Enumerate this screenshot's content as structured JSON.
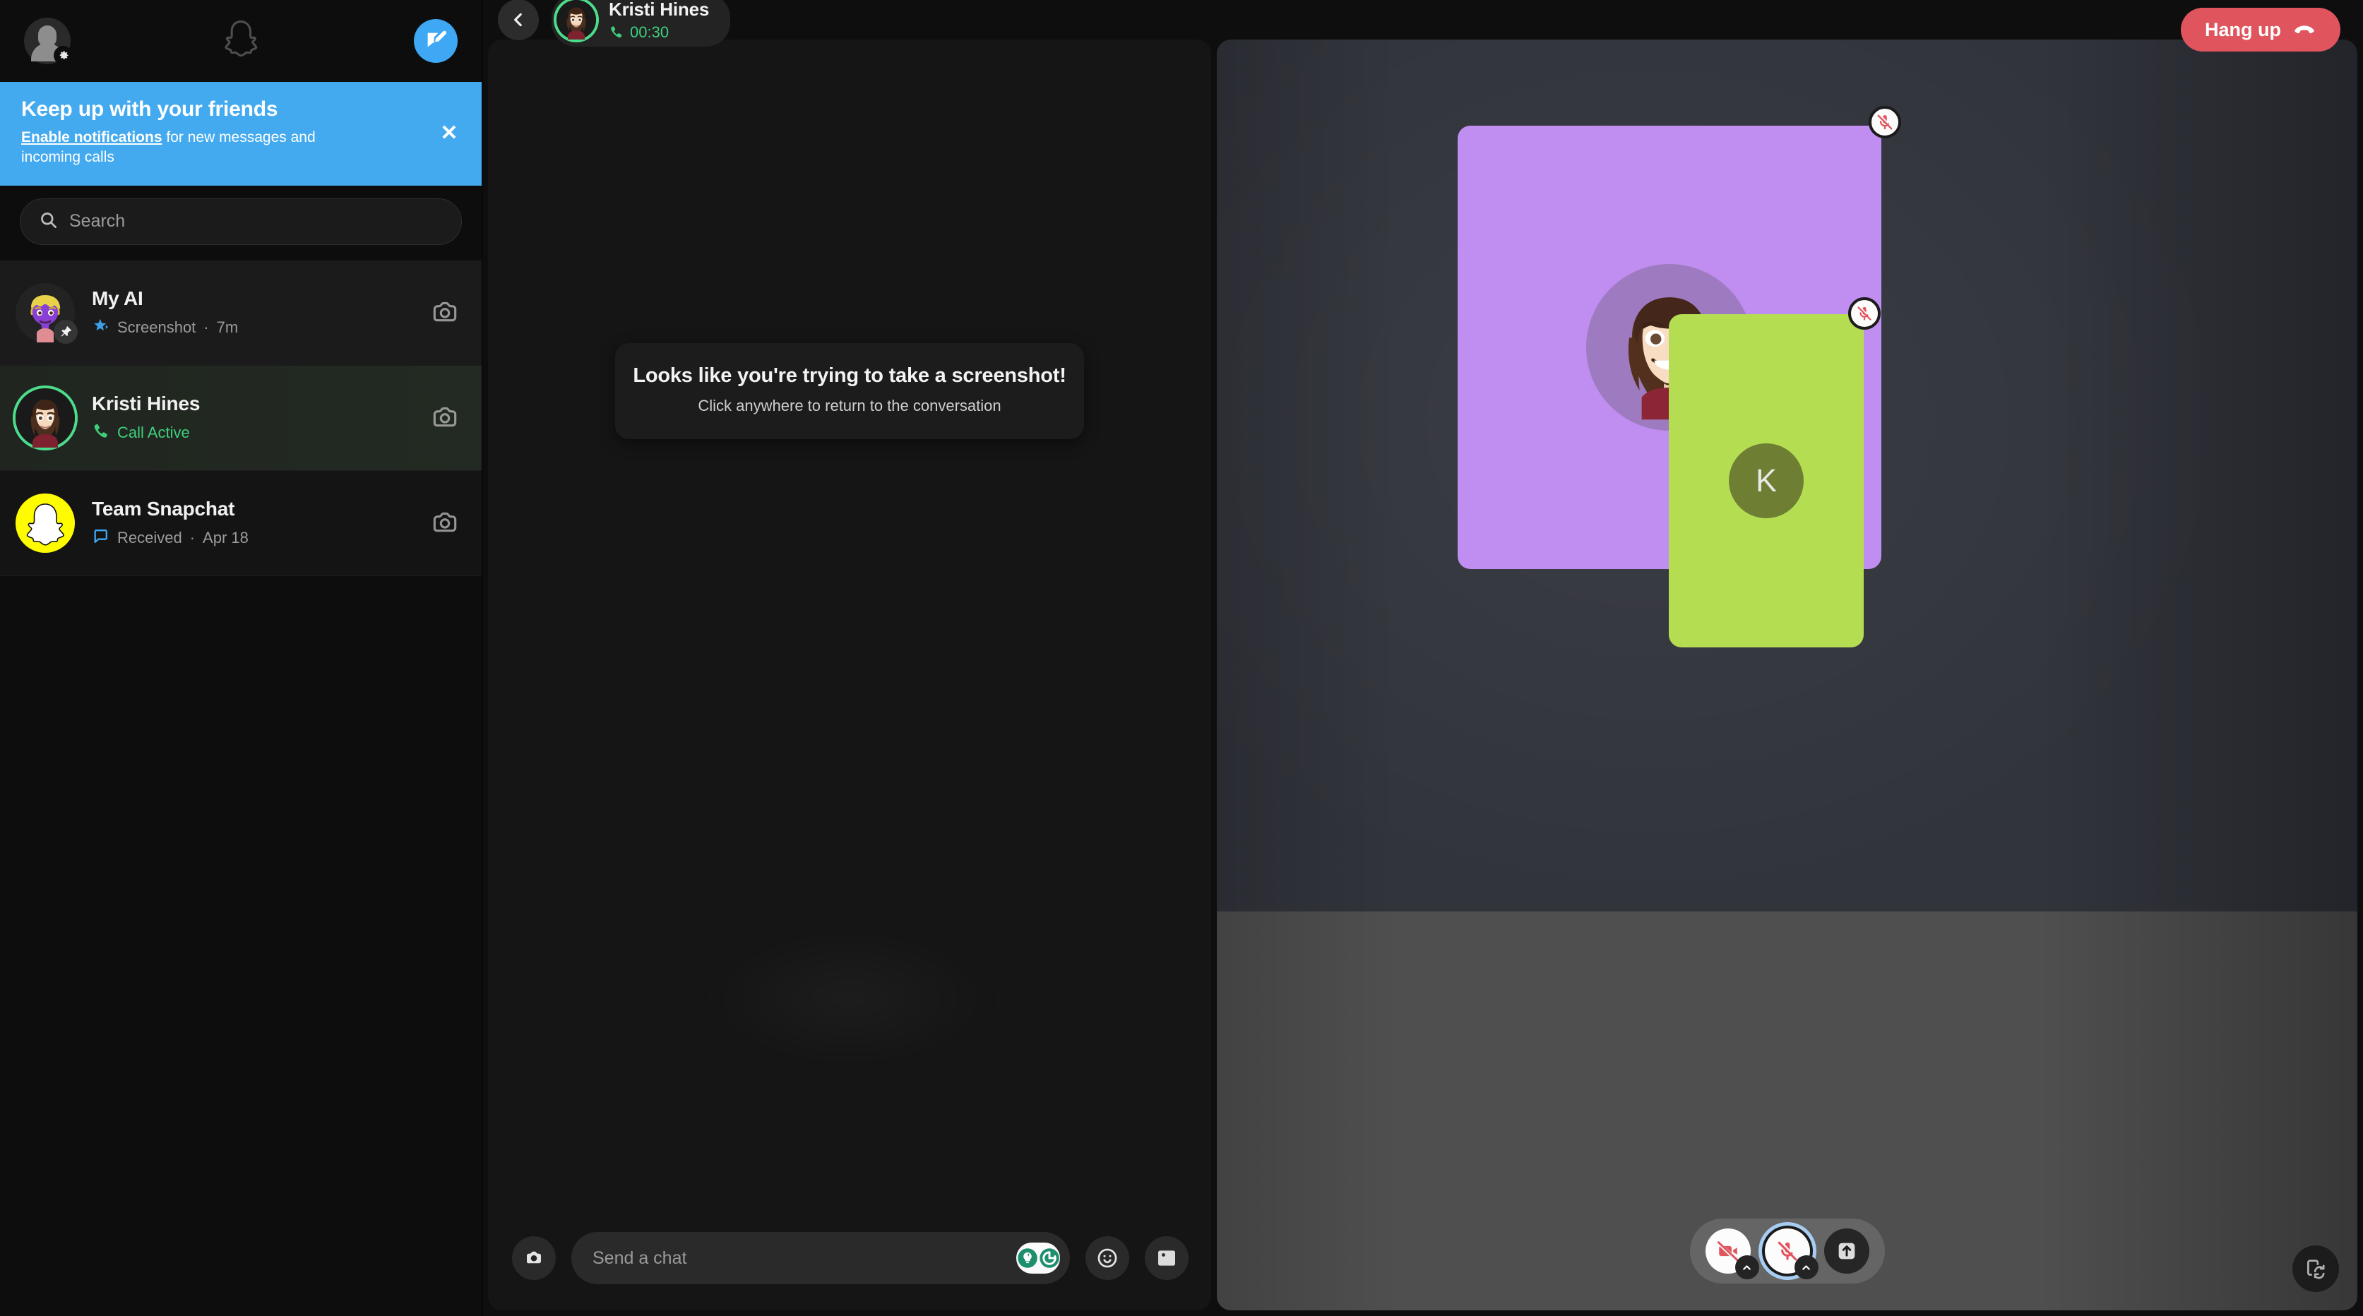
{
  "sidebar": {
    "profile_icon": "person-settings-icon",
    "logo_icon": "snapchat-ghost-icon",
    "compose_icon": "new-chat-icon",
    "notification_banner": {
      "title": "Keep up with your friends",
      "link_text": "Enable notifications",
      "body_rest": " for new messages and incoming calls",
      "close_label": "✕",
      "bg_color": "#44aaf0"
    },
    "search": {
      "placeholder": "Search",
      "value": "",
      "icon": "search-icon"
    },
    "chats": [
      {
        "name": "My AI",
        "status": "Screenshot",
        "separator": "·",
        "time": "7m",
        "status_icon": "screenshot-icon",
        "status_color": "#9b9b9b",
        "badge": "pin-icon",
        "action_icon": "camera-icon",
        "selected": false
      },
      {
        "name": "Kristi Hines",
        "status": "Call Active",
        "separator": "",
        "time": "",
        "status_icon": "phone-icon",
        "status_color": "#3ecf7e",
        "badge": "",
        "action_icon": "camera-icon",
        "selected": true
      },
      {
        "name": "Team Snapchat",
        "status": "Received",
        "separator": "·",
        "time": "Apr 18",
        "status_icon": "chat-bubble-icon",
        "status_color": "#9b9b9b",
        "badge": "",
        "action_icon": "camera-icon",
        "selected": false
      }
    ]
  },
  "call_header": {
    "back_icon": "chevron-left-icon",
    "contact_name": "Kristi Hines",
    "timer": "00:30",
    "timer_icon": "phone-icon",
    "timer_color": "#3ecf7e",
    "hang_up_label": "Hang up",
    "hang_up_icon": "hang-up-icon",
    "hang_up_color": "#e0545e"
  },
  "chat_panel": {
    "toast": {
      "title": "Looks like you're trying to take a screenshot!",
      "subtitle": "Click anywhere to return to the conversation"
    },
    "composer": {
      "camera_icon": "camera-icon",
      "placeholder": "Send a chat",
      "value": "",
      "ai_icon": "ai-lens-icon",
      "emoji_icon": "emoji-icon",
      "sticker_icon": "sticker-image-icon"
    }
  },
  "video_call": {
    "tiles": [
      {
        "id": "main-participant",
        "bg_color": "#c08df0",
        "avatar_type": "bitmoji",
        "avatar_label": "",
        "muted": true,
        "mute_icon": "mic-off-icon"
      },
      {
        "id": "self-participant",
        "bg_color": "#b5dd52",
        "avatar_type": "initial",
        "avatar_label": "K",
        "muted": true,
        "mute_icon": "mic-off-icon"
      }
    ],
    "controls": [
      {
        "id": "camera-toggle",
        "icon": "video-off-icon",
        "state": "off",
        "has_chevron": true,
        "style": "white"
      },
      {
        "id": "mic-toggle",
        "icon": "mic-off-icon",
        "state": "off",
        "has_chevron": true,
        "style": "white-ringed"
      },
      {
        "id": "share-button",
        "icon": "share-upload-icon",
        "state": "on",
        "has_chevron": false,
        "style": "dark"
      }
    ],
    "flip_icon": "flip-screen-icon",
    "mute_icon_color": "#e0545e"
  }
}
